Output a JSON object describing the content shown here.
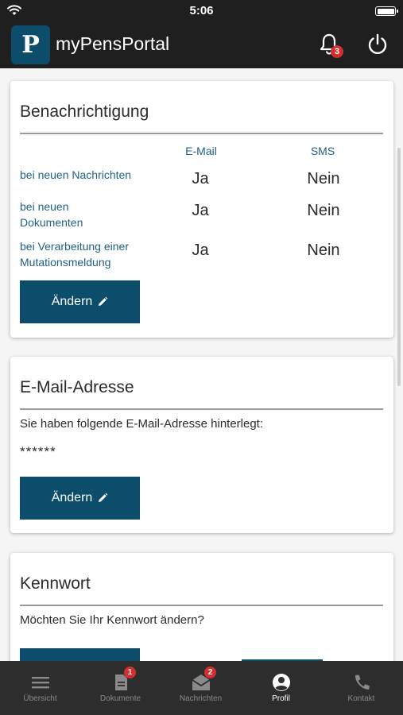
{
  "status": {
    "time": "5:06"
  },
  "app": {
    "logo_letter": "P",
    "title": "myPensPortal",
    "notification_count": "3"
  },
  "notifications_card": {
    "title": "Benachrichtigung",
    "col_email": "E-Mail",
    "col_sms": "SMS",
    "rows": [
      {
        "label": "bei neuen Nachrichten",
        "email": "Ja",
        "sms": "Nein"
      },
      {
        "label": "bei neuen Dokumenten",
        "email": "Ja",
        "sms": "Nein"
      },
      {
        "label": "bei Verarbeitung einer Mutationsmeldung",
        "email": "Ja",
        "sms": "Nein"
      }
    ],
    "button_label": "Ändern"
  },
  "email_card": {
    "title": "E-Mail-Adresse",
    "description": "Sie haben folgende E-Mail-Adresse hinterlegt:",
    "masked_email": "******",
    "button_label": "Ändern"
  },
  "password_card": {
    "title": "Kennwort",
    "description": "Möchten Sie Ihr Kennwort ändern?"
  },
  "tabs": [
    {
      "label": "Übersicht",
      "icon": "menu-icon",
      "badge": ""
    },
    {
      "label": "Dokumente",
      "icon": "document-icon",
      "badge": "1"
    },
    {
      "label": "Nachrichten",
      "icon": "mail-icon",
      "badge": "2"
    },
    {
      "label": "Profil",
      "icon": "account-icon",
      "badge": ""
    },
    {
      "label": "Kontakt",
      "icon": "phone-icon",
      "badge": ""
    }
  ],
  "colors": {
    "primary": "#0c4d6c",
    "header": "#1f1f1f",
    "tabbar": "#2d2d2d",
    "badge": "#d32f2f",
    "link_text": "#1f5f83"
  }
}
